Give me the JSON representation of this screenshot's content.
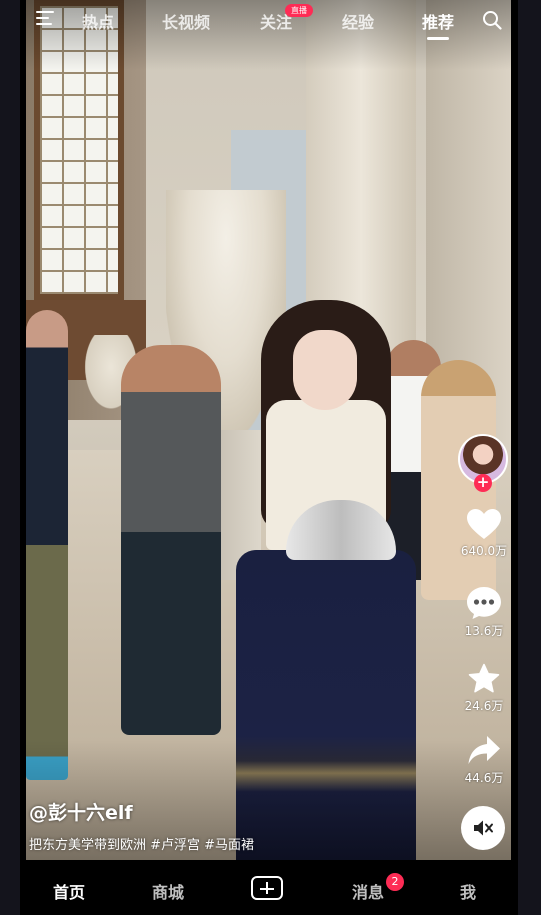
{
  "topnav": {
    "tabs": [
      {
        "label": "热点",
        "active": false
      },
      {
        "label": "长视频",
        "active": false
      },
      {
        "label": "关注",
        "active": false,
        "badge": "直播"
      },
      {
        "label": "经验",
        "active": false
      },
      {
        "label": "推荐",
        "active": true
      }
    ],
    "icons": {
      "menu": "menu-icon",
      "search": "search-icon"
    }
  },
  "actions": {
    "follow_icon": "plus",
    "like": {
      "icon": "heart-icon",
      "count": "640.0万"
    },
    "comment": {
      "icon": "comment-icon",
      "count": "13.6万"
    },
    "favorite": {
      "icon": "star-icon",
      "count": "24.6万"
    },
    "share": {
      "icon": "share-icon",
      "count": "44.6万"
    },
    "mute_icon": "muted-speaker-icon"
  },
  "post": {
    "author": "@彭十六elf",
    "caption": "把东方美学带到欧洲 #卢浮宫 #马面裙"
  },
  "bottombar": {
    "items": [
      {
        "label": "首页",
        "active": true
      },
      {
        "label": "商城",
        "active": false
      },
      {
        "label": "",
        "icon": "plus-icon"
      },
      {
        "label": "消息",
        "active": false,
        "badge": "2"
      },
      {
        "label": "我",
        "active": false
      }
    ]
  },
  "colors": {
    "accent": "#fe2c55",
    "bar_bg": "#000000"
  }
}
